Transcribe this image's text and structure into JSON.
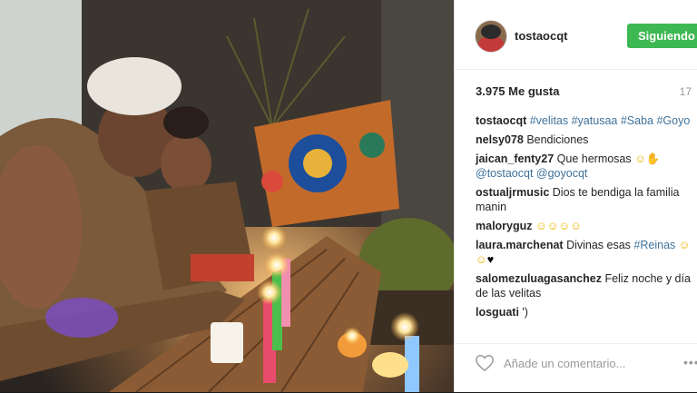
{
  "post": {
    "username": "tostaocqt",
    "follow_label": "Siguiendo",
    "likes": "3.975 Me gusta",
    "time": "17",
    "caption": {
      "user": "tostaocqt",
      "tags": [
        "#velitas",
        "#yatusaa",
        "#Saba",
        "#Goyo"
      ]
    }
  },
  "comments": [
    {
      "user": "nelsy078",
      "text": "Bendiciones"
    },
    {
      "user": "jaican_fenty27",
      "text": "Que hermosas",
      "mentions": [
        "@tostaocqt",
        "@goyocqt"
      ]
    },
    {
      "user": "ostualjrmusic",
      "text": "Dios te bendiga la familia manin"
    },
    {
      "user": "maloryguz",
      "text": ""
    },
    {
      "user": "laura.marchenat",
      "text": "Divinas esas",
      "tag": "#Reinas"
    },
    {
      "user": "salomezuluagasanchez",
      "text": "Feliz noche y día de las velitas"
    },
    {
      "user": "losguati",
      "text": "')"
    }
  ],
  "add_comment": {
    "placeholder": "Añade un comentario..."
  },
  "icons": {
    "like": "heart-icon",
    "more": "more-options-icon"
  },
  "colors": {
    "follow_button": "#3eb852",
    "link": "#3f729b",
    "text": "#262626"
  }
}
